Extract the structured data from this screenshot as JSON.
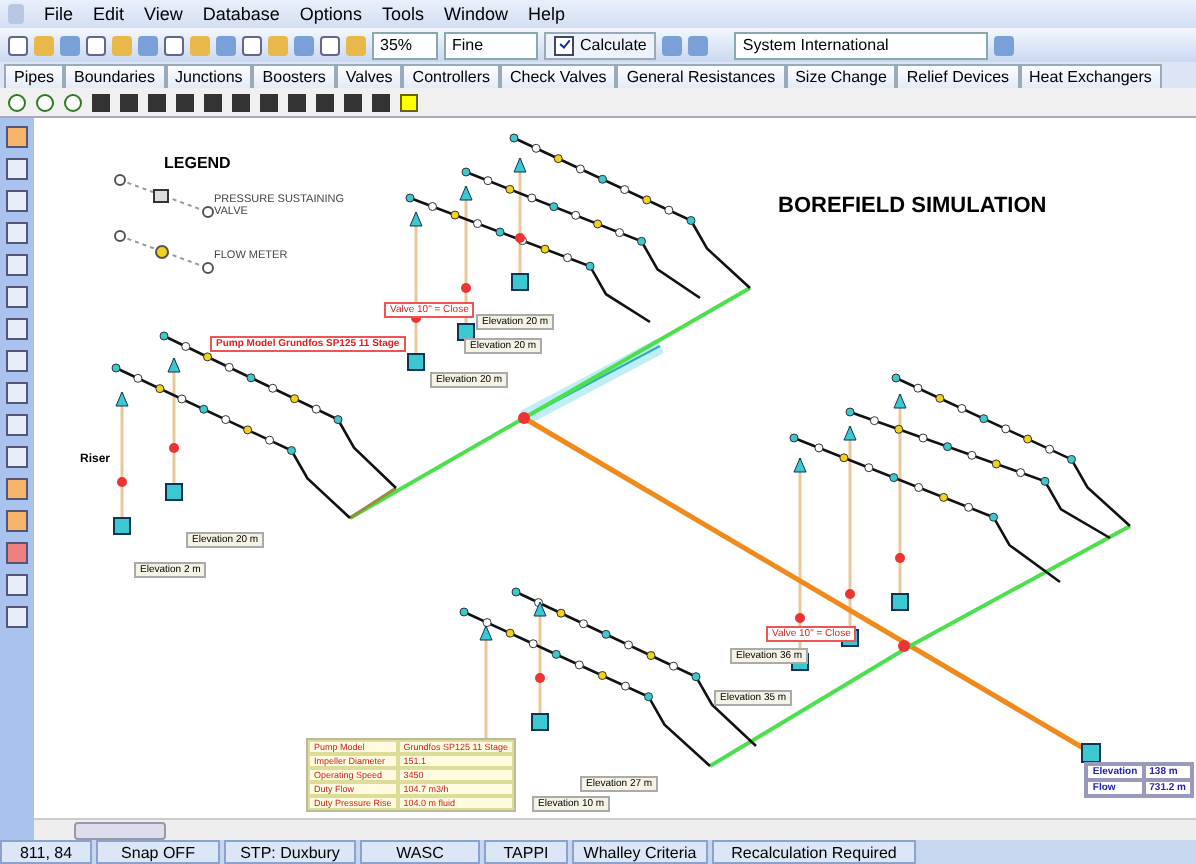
{
  "menu": [
    "File",
    "Edit",
    "View",
    "Database",
    "Options",
    "Tools",
    "Window",
    "Help"
  ],
  "toolbar": {
    "zoom": "35%",
    "quality": "Fine",
    "calculate": {
      "label": "Calculate",
      "checked": true
    },
    "units": "System International"
  },
  "tabs": [
    "Pipes",
    "Boundaries",
    "Junctions",
    "Boosters",
    "Valves",
    "Controllers",
    "Check Valves",
    "General Resistances",
    "Size Change",
    "Relief Devices",
    "Heat Exchangers"
  ],
  "canvas": {
    "legend": {
      "title": "LEGEND",
      "items": [
        {
          "kind": "valve",
          "label": "PRESSURE SUSTAINING VALVE"
        },
        {
          "kind": "meter",
          "label": "FLOW METER"
        }
      ]
    },
    "title": "BOREFIELD SIMULATION",
    "riser_label": "Riser",
    "elevation_tags": [
      {
        "label": "Elevation",
        "value": "20 m"
      },
      {
        "label": "Elevation",
        "value": "20 m"
      },
      {
        "label": "Elevation",
        "value": "20 m"
      },
      {
        "label": "Elevation",
        "value": "20 m"
      },
      {
        "label": "Elevation",
        "value": "2 m"
      },
      {
        "label": "Elevation",
        "value": "36 m"
      },
      {
        "label": "Elevation",
        "value": "35 m"
      },
      {
        "label": "Elevation",
        "value": "27 m"
      },
      {
        "label": "Elevation",
        "value": "10 m"
      }
    ],
    "pump_tag": {
      "label": "Pump Model",
      "value": "Grundfos SP125 11 Stage"
    },
    "valve_tags": [
      {
        "label": "Valve",
        "value": "10\" = Close"
      },
      {
        "label": "Valve",
        "value": "10\" = Close"
      }
    ],
    "pump_table": [
      {
        "label": "Pump Model",
        "value": "Grundfos SP125 11 Stage"
      },
      {
        "label": "Impeller Diameter",
        "value": "151.1"
      },
      {
        "label": "Operating Speed",
        "value": "3450"
      },
      {
        "label": "Duty Flow",
        "value": "104.7 m3/h"
      },
      {
        "label": "Duty Pressure Rise",
        "value": "104.0 m fluid"
      }
    ],
    "result_table": [
      {
        "label": "Elevation",
        "value": "138 m"
      },
      {
        "label": "Flow",
        "value": "731.2 m"
      }
    ]
  },
  "status_bar": [
    "811, 84",
    "Snap OFF",
    "STP: Duxbury",
    "WASC",
    "TAPPI",
    "Whalley Criteria",
    "Recalculation Required"
  ]
}
